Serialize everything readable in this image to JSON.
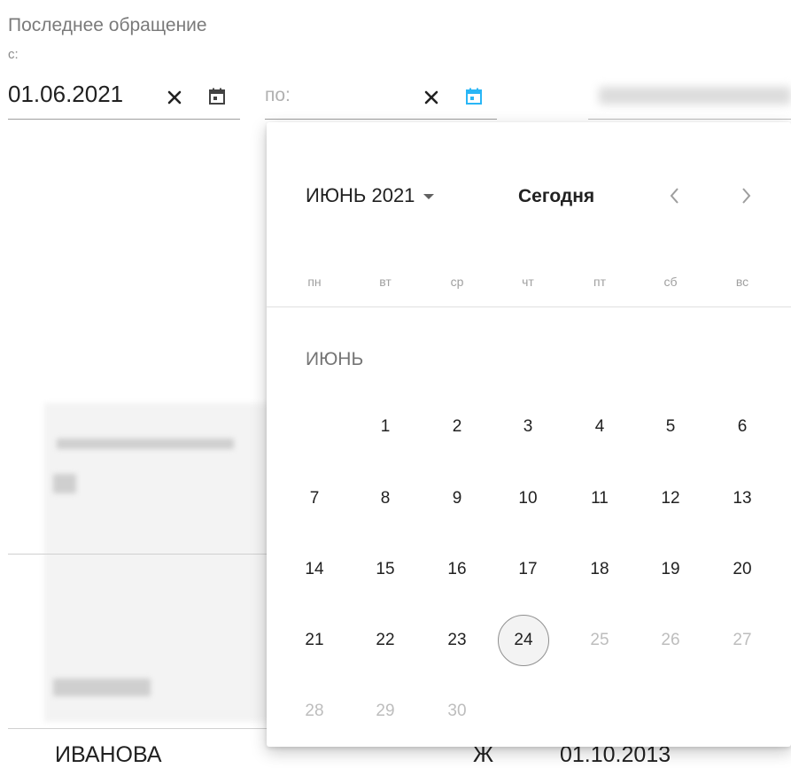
{
  "filter": {
    "label": "Последнее обращение",
    "from_label": "с:",
    "from_value": "01.06.2021",
    "to_placeholder": "по:"
  },
  "icons": {
    "clear": "close-icon",
    "calendar": "calendar-icon",
    "prev": "chevron-left-icon",
    "next": "chevron-right-icon",
    "dropdown": "triangle-down-icon"
  },
  "colors": {
    "active_calendar_icon": "#29b6f6",
    "inactive_text": "#bdbdbd",
    "today_border": "#8f8f8f"
  },
  "datepicker": {
    "month_year": "ИЮНЬ 2021",
    "today_label": "Сегодня",
    "weekdays": [
      "пн",
      "вт",
      "ср",
      "чт",
      "пт",
      "сб",
      "вс"
    ],
    "month_title": "ИЮНЬ",
    "today_day": "24",
    "active_days": [
      "1",
      "2",
      "3",
      "4",
      "5",
      "6",
      "7",
      "8",
      "9",
      "10",
      "11",
      "12",
      "13",
      "14",
      "15",
      "16",
      "17",
      "18",
      "19",
      "20",
      "21",
      "22",
      "23",
      "24"
    ],
    "inactive_days": [
      "25",
      "26",
      "27",
      "28",
      "29",
      "30"
    ]
  },
  "background_row": {
    "name": "ИВАНОВА",
    "gender": "Ж",
    "date": "01.10.2013"
  }
}
